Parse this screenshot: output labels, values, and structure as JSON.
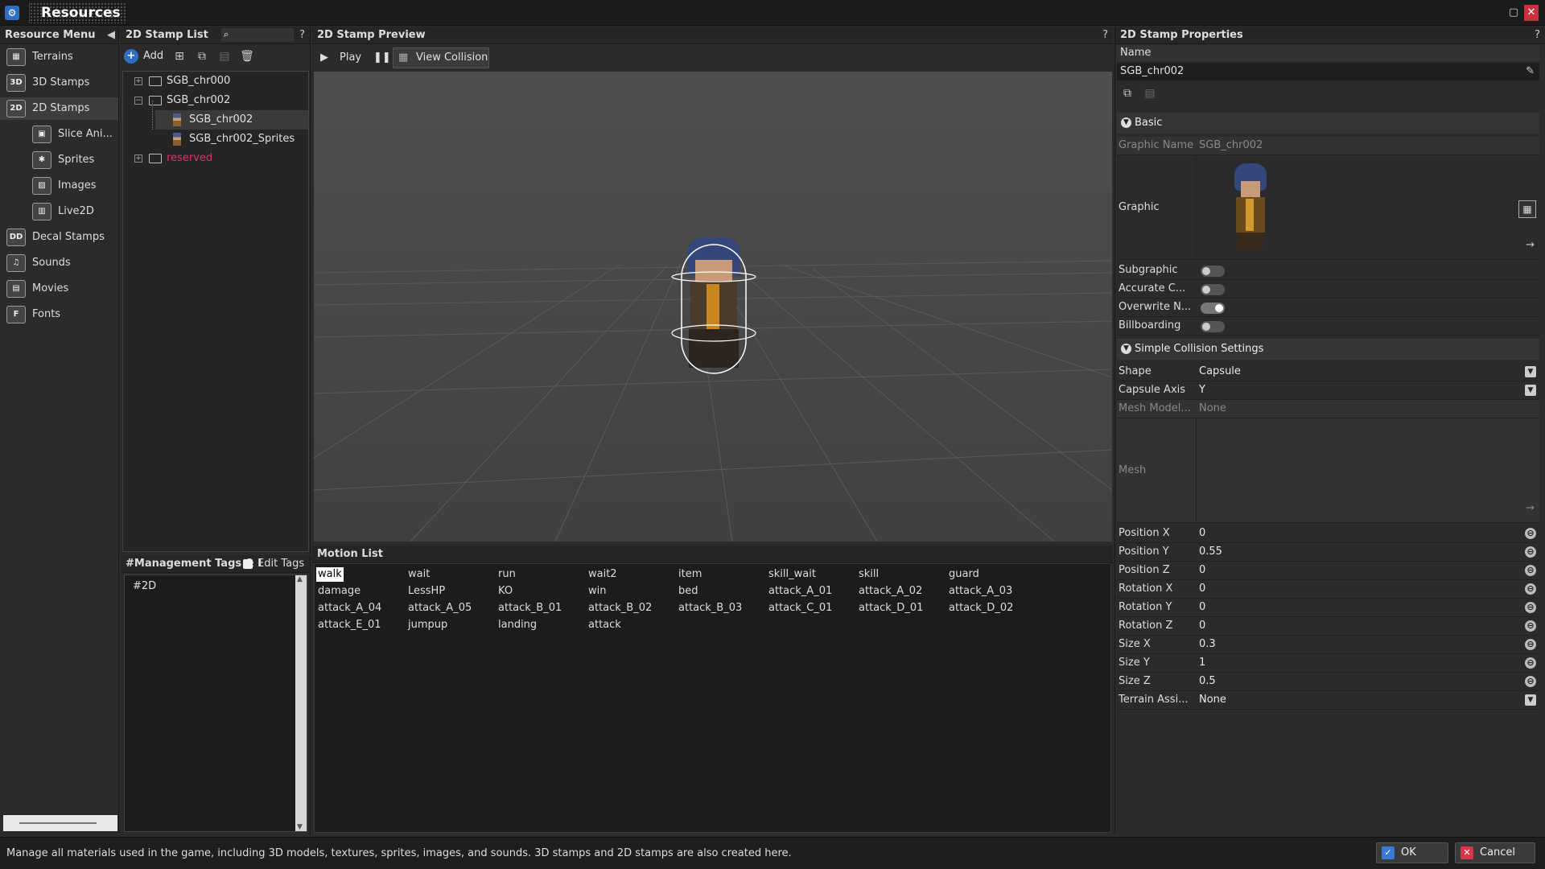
{
  "window": {
    "title": "Resources",
    "app_icon": "gear-icon"
  },
  "resource_menu": {
    "title": "Resource Menu",
    "items": [
      {
        "label": "Terrains",
        "icon": "terrain-icon",
        "abbr": "▦"
      },
      {
        "label": "3D Stamps",
        "icon": "3d-stamp-icon",
        "abbr": "3D"
      },
      {
        "label": "2D Stamps",
        "icon": "2d-stamp-icon",
        "abbr": "2D"
      },
      {
        "label": "Slice Ani...",
        "icon": "slice-animation-icon",
        "abbr": "▣"
      },
      {
        "label": "Sprites",
        "icon": "sprites-icon",
        "abbr": "✱"
      },
      {
        "label": "Images",
        "icon": "images-icon",
        "abbr": "▨"
      },
      {
        "label": "Live2D",
        "icon": "live2d-icon",
        "abbr": "▥"
      },
      {
        "label": "Decal Stamps",
        "icon": "decal-stamp-icon",
        "abbr": "DD"
      },
      {
        "label": "Sounds",
        "icon": "sounds-icon",
        "abbr": "♫"
      },
      {
        "label": "Movies",
        "icon": "movies-icon",
        "abbr": "▤"
      },
      {
        "label": "Fonts",
        "icon": "fonts-icon",
        "abbr": "F"
      }
    ]
  },
  "stamp_list": {
    "title": "2D Stamp List",
    "help": "?",
    "add_label": "Add",
    "tree": [
      {
        "label": "SGB_chr000"
      },
      {
        "label": "SGB_chr002"
      },
      {
        "label": "SGB_chr002"
      },
      {
        "label": "SGB_chr002_Sprites"
      },
      {
        "label": "reserved"
      }
    ]
  },
  "tags": {
    "title": "#Management Tags & I",
    "edit_label": "Edit Tags",
    "items": [
      "#2D"
    ]
  },
  "preview": {
    "title": "2D Stamp Preview",
    "help": "?",
    "play_label": "Play",
    "view_collision_label": "View Collision"
  },
  "motion_list": {
    "title": "Motion List",
    "items": [
      "walk",
      "wait",
      "run",
      "wait2",
      "item",
      "skill_wait",
      "skill",
      "guard",
      "damage",
      "LessHP",
      "KO",
      "win",
      "bed",
      "attack_A_01",
      "attack_A_02",
      "attack_A_03",
      "attack_A_04",
      "attack_A_05",
      "attack_B_01",
      "attack_B_02",
      "attack_B_03",
      "attack_C_01",
      "attack_D_01",
      "attack_D_02",
      "attack_E_01",
      "jumpup",
      "landing",
      "attack"
    ]
  },
  "properties": {
    "title": "2D Stamp Properties",
    "help": "?",
    "name_label": "Name",
    "name_value": "SGB_chr002",
    "basic_section": "Basic",
    "graphic_name_label": "Graphic Name",
    "graphic_name_value": "SGB_chr002",
    "graphic_label": "Graphic",
    "subgraphic_label": "Subgraphic",
    "accurate_label": "Accurate C...",
    "overwrite_label": "Overwrite N...",
    "billboarding_label": "Billboarding",
    "collision_section": "Simple Collision Settings",
    "shape_label": "Shape",
    "shape_value": "Capsule",
    "capsule_axis_label": "Capsule Axis",
    "capsule_axis_value": "Y",
    "mesh_model_label": "Mesh Model...",
    "mesh_model_value": "None",
    "mesh_label": "Mesh",
    "position_x_label": "Position X",
    "position_x_value": "0",
    "position_y_label": "Position Y",
    "position_y_value": "0.55",
    "position_z_label": "Position Z",
    "position_z_value": "0",
    "rotation_x_label": "Rotation X",
    "rotation_x_value": "0",
    "rotation_y_label": "Rotation Y",
    "rotation_y_value": "0",
    "rotation_z_label": "Rotation Z",
    "rotation_z_value": "0",
    "size_x_label": "Size X",
    "size_x_value": "0.3",
    "size_y_label": "Size Y",
    "size_y_value": "1",
    "size_z_label": "Size Z",
    "size_z_value": "0.5",
    "terrain_label": "Terrain Assi...",
    "terrain_value": "None"
  },
  "footer": {
    "status": "Manage all materials used in the game, including 3D models, textures, sprites, images, and sounds. 3D stamps and 2D stamps are also created here.",
    "ok_label": "OK",
    "cancel_label": "Cancel"
  },
  "colors": {
    "accent": "#2e6fc4",
    "reserved_text": "#e0306a",
    "cancel": "#d8354a",
    "ok": "#3a7bd5"
  }
}
